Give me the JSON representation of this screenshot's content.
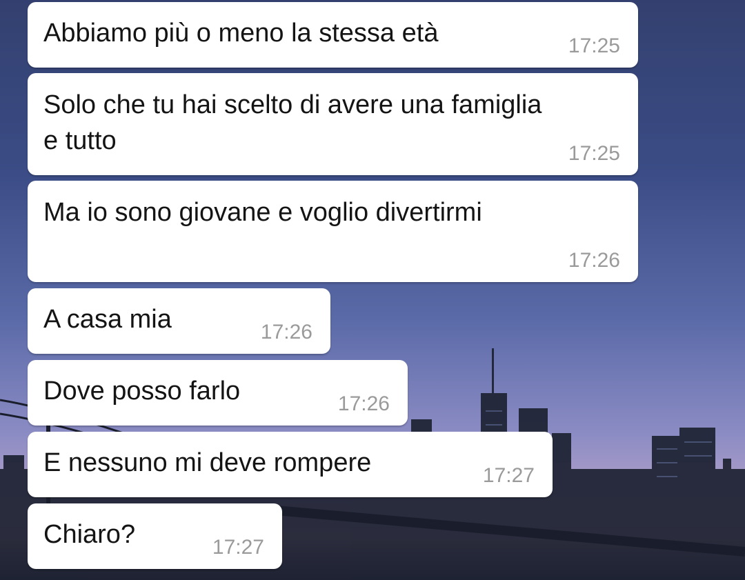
{
  "colors": {
    "bubble": "#ffffff",
    "message_text": "#141414",
    "timestamp": "#9a9a9a",
    "wallpaper_top": "#33406f",
    "wallpaper_horizon": "#c9a0b2"
  },
  "wallpaper": {
    "subject": "city-skyline-with-bridge-at-dusk"
  },
  "messages": [
    {
      "text": "Abbiamo più o meno la stessa età",
      "time": "17:25"
    },
    {
      "text": "Solo che tu hai scelto di avere una famiglia\ne tutto",
      "time": "17:25"
    },
    {
      "text": "Ma io sono giovane e voglio divertirmi",
      "time": "17:26"
    },
    {
      "text": "A casa mia",
      "time": "17:26"
    },
    {
      "text": "Dove posso farlo",
      "time": "17:26"
    },
    {
      "text": "E nessuno mi deve rompere",
      "time": "17:27"
    },
    {
      "text": "Chiaro?",
      "time": "17:27"
    }
  ]
}
